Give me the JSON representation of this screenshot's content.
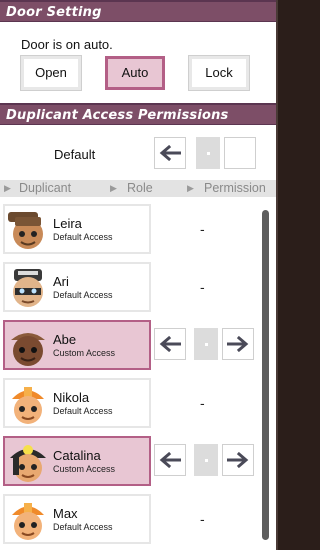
{
  "door": {
    "title": "Door Setting",
    "status": "Door is on auto.",
    "modes": [
      {
        "label": "Open",
        "active": false
      },
      {
        "label": "Auto",
        "active": true
      },
      {
        "label": "Lock",
        "active": false
      }
    ]
  },
  "permissions": {
    "title": "Duplicant Access Permissions",
    "default_label": "Default",
    "columns": [
      "Duplicant",
      "Role",
      "Permission"
    ],
    "rows": [
      {
        "name": "Leira",
        "access": "Default Access",
        "custom": false,
        "hat": "none"
      },
      {
        "name": "Ari",
        "access": "Default Access",
        "custom": false,
        "hat": "helmet"
      },
      {
        "name": "Abe",
        "access": "Custom Access",
        "custom": true,
        "hat": "brown-cap"
      },
      {
        "name": "Nikola",
        "access": "Default Access",
        "custom": false,
        "hat": "orange-hardhat"
      },
      {
        "name": "Catalina",
        "access": "Custom Access",
        "custom": true,
        "hat": "miner-lamp"
      },
      {
        "name": "Max",
        "access": "Default Access",
        "custom": false,
        "hat": "orange-hardhat"
      }
    ],
    "dash": "-"
  },
  "icons": {
    "left": "arrow-left-icon",
    "right": "arrow-right-icon",
    "center": "center-dot-icon"
  },
  "colors": {
    "header": "#7d4e67",
    "selected_fill": "#e8c6d3",
    "selected_border": "#b35f86"
  }
}
